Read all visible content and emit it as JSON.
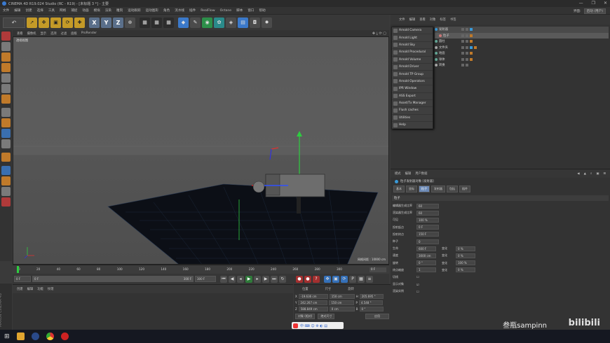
{
  "window": {
    "title": "CINEMA 4D R19.024 Studio (RC - R19) - [未标题 3 *] - 主要",
    "controls": [
      "—",
      "❐",
      "✕"
    ]
  },
  "menubar": {
    "items": [
      "文件",
      "编辑",
      "创建",
      "选择",
      "工具",
      "网格",
      "捕捉",
      "动画",
      "模拟",
      "渲染",
      "雕刻",
      "运动跟踪",
      "运动图形",
      "角色",
      "流水线",
      "插件",
      "RealFlow",
      "Octane",
      "脚本",
      "窗口",
      "帮助"
    ],
    "layout_label": "界面:",
    "layout_value": "启动 (用户)"
  },
  "viewport": {
    "menu": [
      "查看",
      "摄像机",
      "显示",
      "选项",
      "过滤",
      "面板",
      "ProRender"
    ],
    "label": "透视视图",
    "grid_spacing": "网格间距 : 10000 cm"
  },
  "timeline": {
    "ticks": [
      "0",
      "20",
      "40",
      "60",
      "80",
      "100",
      "120",
      "140",
      "160",
      "180",
      "200",
      "220",
      "240",
      "260",
      "280",
      "300"
    ],
    "current_frame": "0 F"
  },
  "transport": {
    "start": "0 F",
    "start2": "0 F",
    "end": "300 F",
    "end2": "300 F"
  },
  "material_panel": {
    "menu": [
      "创建",
      "编辑",
      "功能",
      "纹理"
    ]
  },
  "coordinates": {
    "headers": [
      "位置",
      "尺寸",
      "旋转"
    ],
    "rows": [
      {
        "axis": "X",
        "pos": "-19.636 cm",
        "size": "150 cm",
        "rot_axis": "H",
        "rot": "205.695 °"
      },
      {
        "axis": "Y",
        "pos": "242.267 cm",
        "size": "150 cm",
        "rot_axis": "P",
        "rot": "4.548 °"
      },
      {
        "axis": "Z",
        "pos": "588.849 cm",
        "size": "0 cm",
        "rot_axis": "B",
        "rot": "0 °"
      }
    ],
    "mode": "对象 (相对)",
    "size_mode": "绝对尺寸",
    "apply": "应用"
  },
  "object_panel": {
    "menu": [
      "文件",
      "编辑",
      "查看",
      "对象",
      "标签",
      "书签"
    ],
    "tree": [
      {
        "name": "发射器",
        "color": "#3a9ad9"
      },
      {
        "name": "粒子",
        "color": "#c77"
      },
      {
        "name": "圆柱",
        "color": "#6a9"
      },
      {
        "name": "文件夹",
        "color": "#aaa"
      },
      {
        "name": "地面",
        "color": "#6a9"
      },
      {
        "name": "球体",
        "color": "#6a9"
      },
      {
        "name": "转换",
        "color": "#aaa"
      }
    ]
  },
  "arnold_menu": {
    "items": [
      "Arnold Camera",
      "Arnold Light",
      "Arnold Sky",
      "Arnold Procedural",
      "Arnold Volume",
      "Arnold Driver",
      "Arnold TP Group",
      "Arnold Operators",
      "IPR Window",
      "ASS Export",
      "Asset/Tx Manager",
      "Flush caches",
      "Utilities",
      "Help"
    ]
  },
  "attributes": {
    "menu": [
      "模式",
      "编辑",
      "用户数据"
    ],
    "title": "粒子发射器对象 [发射器]",
    "tabs": [
      "基本",
      "坐标",
      "粒子",
      "发射器",
      "包括",
      "插件"
    ],
    "active_tab": "粒子",
    "section": "粒子",
    "rows": [
      {
        "label": "编辑器生成比率",
        "value": "60"
      },
      {
        "label": "渲染器生成比率",
        "value": "60"
      },
      {
        "label": "可见",
        "value": "100 %"
      },
      {
        "label": "投射起点",
        "value": "0 F"
      },
      {
        "label": "投射终点",
        "value": "150 F"
      },
      {
        "label": "种子",
        "value": "0"
      },
      {
        "label": "生命",
        "value": "600 F",
        "var_label": "变化",
        "var": "0 %"
      },
      {
        "label": "速度",
        "value": "3000 cm",
        "var_label": "变化",
        "var": "0 %"
      },
      {
        "label": "旋转",
        "value": "0 °",
        "var_label": "变化",
        "var": "100 %"
      },
      {
        "label": "终点缩放",
        "value": "1",
        "var_label": "变化",
        "var": "0 %"
      },
      {
        "label": "切线",
        "value": "☐"
      },
      {
        "label": "显示对象",
        "value": "☑"
      },
      {
        "label": "渲染实例",
        "value": "☐"
      }
    ]
  },
  "watermark": {
    "text1": "叁瓶sampinn",
    "text2": "bilibili"
  }
}
